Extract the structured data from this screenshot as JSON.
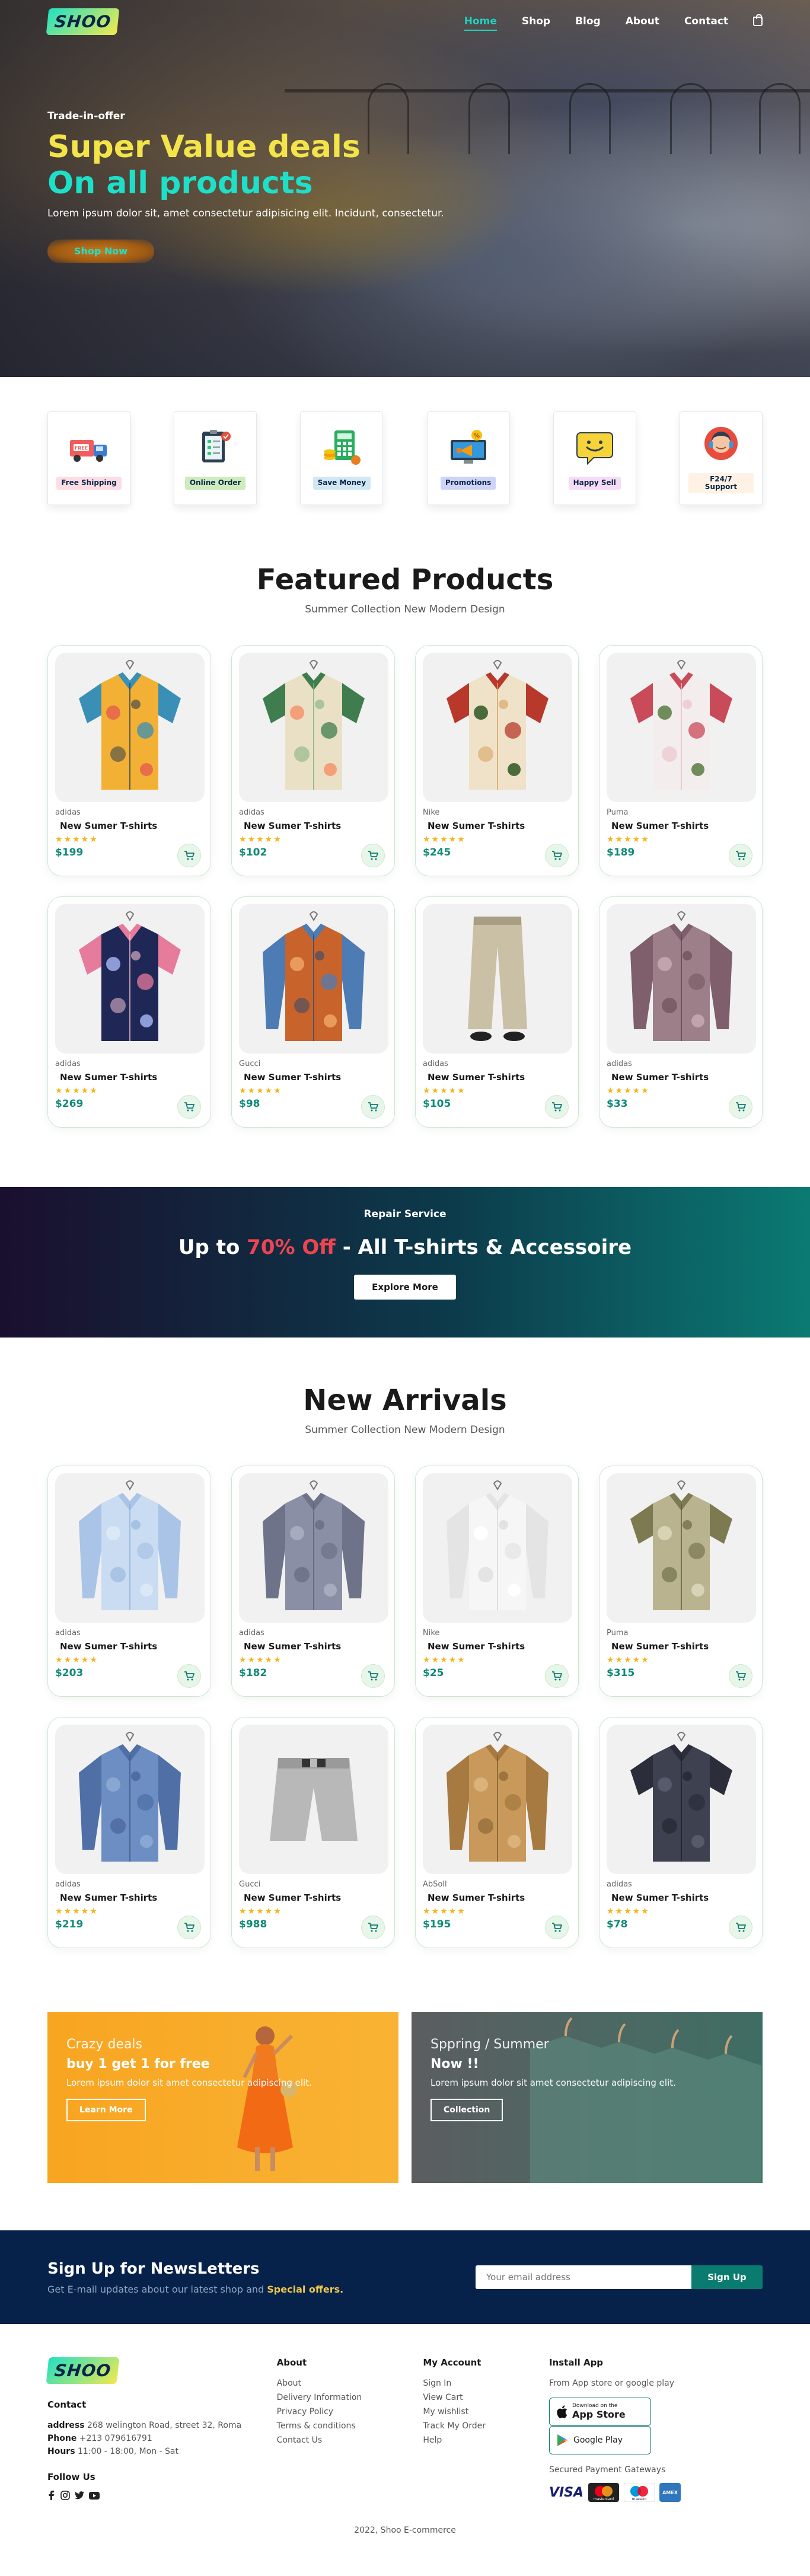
{
  "brand": {
    "logo": "SHOO"
  },
  "nav": {
    "items": [
      {
        "label": "Home",
        "active": true
      },
      {
        "label": "Shop",
        "active": false
      },
      {
        "label": "Blog",
        "active": false
      },
      {
        "label": "About",
        "active": false
      },
      {
        "label": "Contact",
        "active": false
      }
    ],
    "cart_icon": "shopping-bag-icon"
  },
  "hero": {
    "kicker": "Trade-in-offer",
    "line1": "Super Value deals",
    "line2": "On all products",
    "text": "Lorem ipsum dolor sit, amet consectetur adipisicing elit. Incidunt, consectetur.",
    "button": "Shop Now"
  },
  "features": [
    {
      "label": "Free Shipping",
      "icon": "free-shipping-truck-icon",
      "tag_color": "#fddde4"
    },
    {
      "label": "Online Order",
      "icon": "online-order-clipboard-icon",
      "tag_color": "#cdebbc"
    },
    {
      "label": "Save Money",
      "icon": "save-money-calculator-icon",
      "tag_color": "#d1e8f2"
    },
    {
      "label": "Promotions",
      "icon": "promotions-megaphone-icon",
      "tag_color": "#cdd4f8"
    },
    {
      "label": "Happy Sell",
      "icon": "happy-sell-emoji-icon",
      "tag_color": "#f6dbf6"
    },
    {
      "label": "F24/7 Support",
      "icon": "support-agent-icon",
      "tag_color": "#fff2e5"
    }
  ],
  "featured": {
    "title": "Featured Products",
    "subtitle": "Summer Collection New Modern Design",
    "products": [
      {
        "brand": "adidas",
        "name": "New Sumer T-shirts",
        "stars": "★★★★★",
        "price": "$199",
        "img": "shirt-colorful-abstract"
      },
      {
        "brand": "adidas",
        "name": "New Sumer T-shirts",
        "stars": "★★★★★",
        "price": "$102",
        "img": "shirt-floral-green"
      },
      {
        "brand": "Nike",
        "name": "New Sumer T-shirts",
        "stars": "★★★★★",
        "price": "$245",
        "img": "shirt-floral-red"
      },
      {
        "brand": "Puma",
        "name": "New Sumer T-shirts",
        "stars": "★★★★★",
        "price": "$189",
        "img": "shirt-floral-white"
      },
      {
        "brand": "adidas",
        "name": "New Sumer T-shirts",
        "stars": "★★★★★",
        "price": "$269",
        "img": "shirt-floral-navy"
      },
      {
        "brand": "Gucci",
        "name": "New Sumer T-shirts",
        "stars": "★★★★★",
        "price": "$98",
        "img": "shirt-orange-denim"
      },
      {
        "brand": "adidas",
        "name": "New Sumer T-shirts",
        "stars": "★★★★★",
        "price": "$105",
        "img": "pants-khaki"
      },
      {
        "brand": "adidas",
        "name": "New Sumer T-shirts",
        "stars": "★★★★★",
        "price": "$33",
        "img": "blouse-mauve"
      }
    ]
  },
  "banner": {
    "kicker": "Repair Service",
    "prefix": "Up to",
    "highlight": "70% Off",
    "suffix": "- All T-shirts & Accessoire",
    "button": "Explore More"
  },
  "arrivals": {
    "title": "New Arrivals",
    "subtitle": "Summer Collection New Modern Design",
    "products": [
      {
        "brand": "adidas",
        "name": "New Sumer T-shirts",
        "stars": "★★★★★",
        "price": "$203",
        "img": "shirt-light-blue"
      },
      {
        "brand": "adidas",
        "name": "New Sumer T-shirts",
        "stars": "★★★★★",
        "price": "$182",
        "img": "shirt-grey-check"
      },
      {
        "brand": "Nike",
        "name": "New Sumer T-shirts",
        "stars": "★★★★★",
        "price": "$25",
        "img": "shirt-white"
      },
      {
        "brand": "Puma",
        "name": "New Sumer T-shirts",
        "stars": "★★★★★",
        "price": "$315",
        "img": "shirt-olive-print"
      },
      {
        "brand": "adidas",
        "name": "New Sumer T-shirts",
        "stars": "★★★★★",
        "price": "$219",
        "img": "shirt-denim-blue"
      },
      {
        "brand": "Gucci",
        "name": "New Sumer T-shirts",
        "stars": "★★★★★",
        "price": "$988",
        "img": "shorts-grey"
      },
      {
        "brand": "AbSoll",
        "name": "New Sumer T-shirts",
        "stars": "★★★★★",
        "price": "$195",
        "img": "jacket-tan"
      },
      {
        "brand": "adidas",
        "name": "New Sumer T-shirts",
        "stars": "★★★★★",
        "price": "$78",
        "img": "shirt-charcoal-short"
      }
    ]
  },
  "promos": [
    {
      "small": "Crazy deals",
      "big": "buy 1 get 1 for free",
      "text": "Lorem ipsum dolor sit amet consectetur adipiscing elit.",
      "button": "Learn More"
    },
    {
      "small": "Sppring / Summer",
      "big": "Now !!",
      "text": "Lorem ipsum dolor sit amet consectetur adipiscing elit.",
      "button": "Collection"
    }
  ],
  "newsletter": {
    "title": "Sign Up for NewsLetters",
    "text": "Get E-mail updates about our latest shop and",
    "highlight": "Special offers.",
    "placeholder": "Your email address",
    "button": "Sign Up"
  },
  "footer": {
    "contact_title": "Contact",
    "address_label": "address",
    "address": "268 welington Road, street 32, Roma",
    "phone_label": "Phone",
    "phone": "+213 079616791",
    "hours_label": "Hours",
    "hours": "11:00 - 18:00, Mon - Sat",
    "follow": "Follow Us",
    "social_icons": [
      "facebook-icon",
      "instagram-icon",
      "twitter-icon",
      "youtube-icon"
    ],
    "about_title": "About",
    "about_links": [
      "About",
      "Delivery Information",
      "Privacy Policy",
      "Terms & conditions",
      "Contact Us"
    ],
    "account_title": "My Account",
    "account_links": [
      "Sign In",
      "View Cart",
      "My wishlist",
      "Track My Order",
      "Help"
    ],
    "install_title": "Install App",
    "install_text": "From App store or google play",
    "app_store_small": "Download on the",
    "app_store": "App Store",
    "google_play": "Google Play",
    "payments_text": "Secured Payment Gateways",
    "payments": [
      "VISA",
      "mastercard",
      "maestro",
      "AMEX"
    ],
    "copyright": "2022, Shoo E-commerce"
  },
  "colors": {
    "accent": "#0a7c6f",
    "hero_yellow": "#f3e44a",
    "hero_teal": "#1ee0c9",
    "sale_red": "#ee4452",
    "navy": "#06214a"
  }
}
